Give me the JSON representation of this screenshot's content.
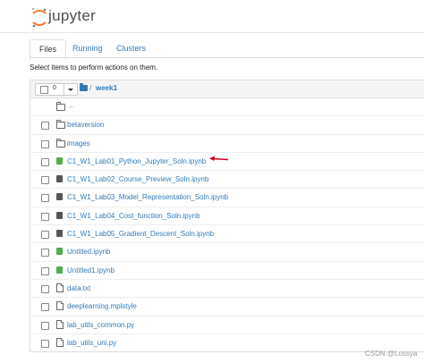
{
  "app": {
    "logo_text": "jupyter"
  },
  "tabs": [
    {
      "label": "Files",
      "active": true
    },
    {
      "label": "Running",
      "active": false
    },
    {
      "label": "Clusters",
      "active": false
    }
  ],
  "hint": "Select items to perform actions on them.",
  "selection": {
    "count": "0"
  },
  "breadcrumb": {
    "separator": "/",
    "dir": "week1"
  },
  "parent_dir_label": "..",
  "items": [
    {
      "name": "betaversion",
      "type": "folder"
    },
    {
      "name": "images",
      "type": "folder"
    },
    {
      "name": "C1_W1_Lab01_Python_Jupyter_Soln.ipynb",
      "type": "notebook-running"
    },
    {
      "name": "C1_W1_Lab02_Course_Preview_Soln.ipynb",
      "type": "notebook"
    },
    {
      "name": "C1_W1_Lab03_Model_Representation_Soln.ipynb",
      "type": "notebook"
    },
    {
      "name": "C1_W1_Lab04_Cost_function_Soln.ipynb",
      "type": "notebook"
    },
    {
      "name": "C1_W1_Lab05_Gradient_Descent_Soln.ipynb",
      "type": "notebook"
    },
    {
      "name": "Untitled.ipynb",
      "type": "notebook-running"
    },
    {
      "name": "Untitled1.ipynb",
      "type": "notebook-running"
    },
    {
      "name": "data.txt",
      "type": "file"
    },
    {
      "name": "deeplearning.mplstyle",
      "type": "file"
    },
    {
      "name": "lab_utils_common.py",
      "type": "file"
    },
    {
      "name": "lab_utils_uni.py",
      "type": "file"
    }
  ],
  "colors": {
    "accent": "#337ab7",
    "running_notebook": "#4caf50",
    "logo_orange": "#f37726",
    "annotation_arrow": "#d0021b"
  },
  "watermark": "CSDN @Lossya"
}
